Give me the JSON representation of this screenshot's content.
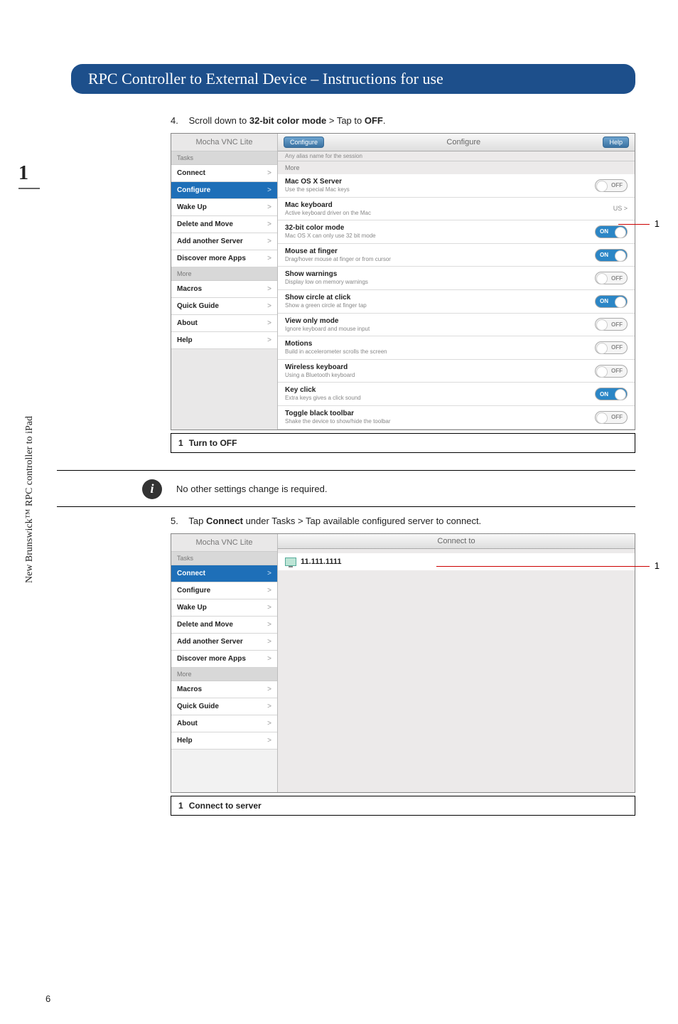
{
  "side_rail_text": "New Brunswick™ RPC controller to iPad",
  "side_page_number": "1",
  "header_title": "RPC Controller to External Device  –  Instructions for use",
  "step4": {
    "number": "4.",
    "prefix": "Scroll down to ",
    "bold1": "32-bit color mode",
    "middle": " > Tap to ",
    "bold2": "OFF",
    "suffix": "."
  },
  "info_text": "No other settings change is required.",
  "step5": {
    "number": "5.",
    "prefix": "Tap ",
    "bold1": "Connect",
    "suffix": " under Tasks > Tap available configured server to connect."
  },
  "screenshot1": {
    "app_title": "Mocha VNC Lite",
    "sections": [
      "Tasks",
      "More"
    ],
    "tasks": [
      "Connect",
      "Configure",
      "Wake Up",
      "Delete and Move",
      "Add another Server",
      "Discover more Apps"
    ],
    "more": [
      "Macros",
      "Quick Guide",
      "About",
      "Help"
    ],
    "selected": "Configure",
    "top_back": "Configure",
    "top_title": "Configure",
    "top_help": "Help",
    "subheader": "Any alias name for the session",
    "main_section": "More",
    "rows": [
      {
        "title": "Mac OS X Server",
        "sub": "Use the special Mac keys",
        "ctrl": "toggle",
        "state": "off"
      },
      {
        "title": "Mac keyboard",
        "sub": "Active keyboard driver on the Mac",
        "ctrl": "select",
        "value": "US"
      },
      {
        "title": "32-bit color mode",
        "sub": "Mac OS X can only use 32 bit mode",
        "ctrl": "toggle",
        "state": "on",
        "callout": true
      },
      {
        "title": "Mouse at finger",
        "sub": "Drag/hover mouse at finger or from cursor",
        "ctrl": "toggle",
        "state": "on"
      },
      {
        "title": "Show warnings",
        "sub": "Display low on memory warnings",
        "ctrl": "toggle",
        "state": "off"
      },
      {
        "title": "Show circle at click",
        "sub": "Show a green circle at finger tap",
        "ctrl": "toggle",
        "state": "on"
      },
      {
        "title": "View only mode",
        "sub": "Ignore keyboard and mouse input",
        "ctrl": "toggle",
        "state": "off"
      },
      {
        "title": "Motions",
        "sub": "Build in accelerometer scrolls the screen",
        "ctrl": "toggle",
        "state": "off"
      },
      {
        "title": "Wireless keyboard",
        "sub": "Using a Bluetooth keyboard",
        "ctrl": "toggle",
        "state": "off"
      },
      {
        "title": "Key click",
        "sub": "Extra keys gives a click sound",
        "ctrl": "toggle",
        "state": "on"
      },
      {
        "title": "Toggle black toolbar",
        "sub": "Shake the device to show/hide the toolbar",
        "ctrl": "toggle",
        "state": "off"
      }
    ],
    "callout_number": "1",
    "caption_num": "1",
    "caption_text": "Turn to OFF"
  },
  "screenshot2": {
    "app_title": "Mocha VNC Lite",
    "sections": [
      "Tasks",
      "More"
    ],
    "tasks": [
      "Connect",
      "Configure",
      "Wake Up",
      "Delete and Move",
      "Add another Server",
      "Discover more Apps"
    ],
    "more": [
      "Macros",
      "Quick Guide",
      "About",
      "Help"
    ],
    "selected": "Connect",
    "top_title": "Connect to",
    "server_ip": "11.111.1111",
    "callout_number": "1",
    "caption_num": "1",
    "caption_text": "Connect to server"
  },
  "footer_page": "6",
  "labels": {
    "on": "ON",
    "off": "OFF",
    "chevron": ">"
  }
}
